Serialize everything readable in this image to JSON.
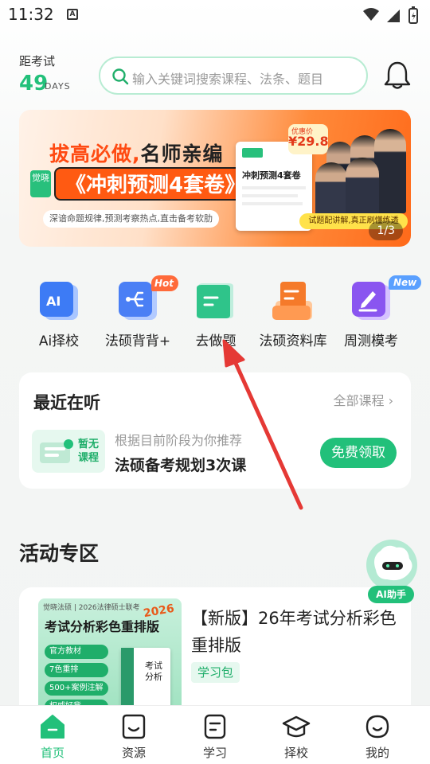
{
  "status_bar": {
    "time": "11:32",
    "notif_letter": "A"
  },
  "header": {
    "countdown_label": "距考试",
    "countdown_days": "49",
    "countdown_unit": "DAYS",
    "search_placeholder": "输入关键词搜索课程、法条、题目"
  },
  "banner": {
    "line1_a": "拔高必做,",
    "line1_b": "名师亲编",
    "tag": "觉晓",
    "line2": "《冲刺预测4套卷》",
    "subline": "深谙命题规律,预测考察热点,直击备考软肋",
    "price_label": "优惠价",
    "price": "¥29.8",
    "book_title": "冲刺预测4套卷",
    "ribbon": "试题配讲解,真正刷懂练透",
    "pager": "1/3"
  },
  "quick_actions": [
    {
      "label": "Ai择校",
      "icon": "ai-school-icon",
      "color": "#3d7bf5"
    },
    {
      "label": "法硕背背+",
      "icon": "flashcard-icon",
      "color": "#4a7ff5",
      "badge": "Hot"
    },
    {
      "label": "去做题",
      "icon": "practice-icon",
      "color": "#2fc48a"
    },
    {
      "label": "法硕资料库",
      "icon": "library-icon",
      "color": "#f57a2a"
    },
    {
      "label": "周测模考",
      "icon": "weekly-test-icon",
      "color": "#8a55f0",
      "badge": "New"
    }
  ],
  "recent": {
    "title": "最近在听",
    "all_link": "全部课程 ›",
    "empty_label": "暂无课程",
    "hint": "根据目前阶段为你推荐",
    "course": "法硕备考规划3次课",
    "claim_button": "免费领取"
  },
  "activities": {
    "section_title": "活动专区",
    "ai_helper": "AI助手",
    "card": {
      "cover_top": "觉晓法硕 | 2026法律硕士联考",
      "cover_title": "考试分析彩色重排版",
      "cover_year": "2026",
      "cover_points": [
        "官方教材",
        "7色重排",
        "500+案例注解",
        "权威好背"
      ],
      "book_text": "考试分析",
      "title": "【新版】26年考试分析彩色重排版",
      "tag": "学习包"
    }
  },
  "bottom_nav": [
    {
      "label": "首页",
      "icon": "home-icon",
      "active": true
    },
    {
      "label": "资源",
      "icon": "resource-icon",
      "active": false
    },
    {
      "label": "学习",
      "icon": "study-icon",
      "active": false
    },
    {
      "label": "择校",
      "icon": "school-icon",
      "active": false
    },
    {
      "label": "我的",
      "icon": "profile-icon",
      "active": false
    }
  ],
  "colors": {
    "brand": "#22c07a",
    "annotation": "#e53935"
  }
}
